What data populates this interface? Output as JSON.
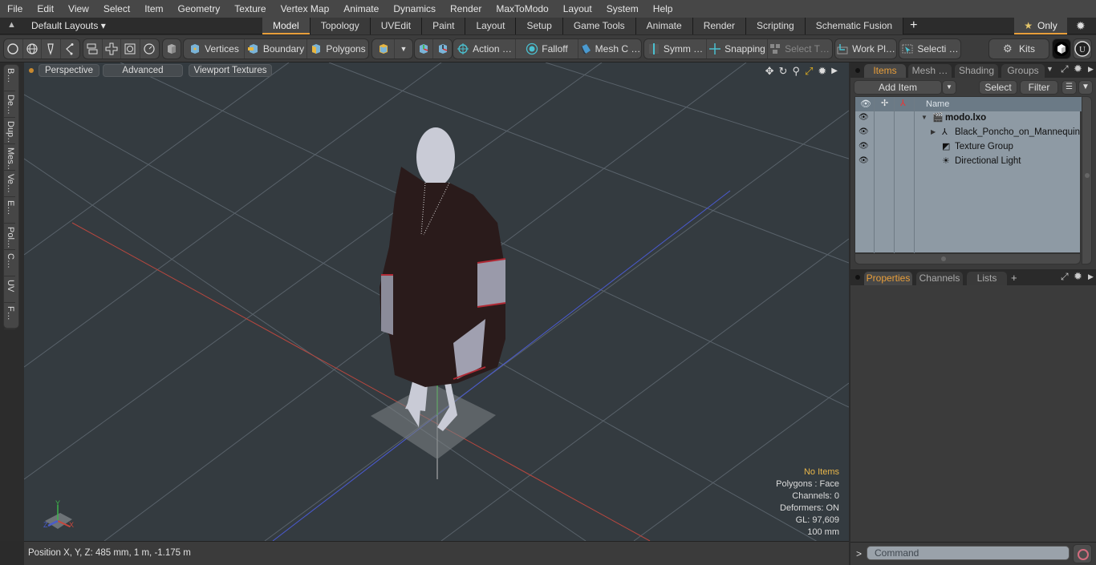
{
  "menubar": {
    "items": [
      "File",
      "Edit",
      "View",
      "Select",
      "Item",
      "Geometry",
      "Texture",
      "Vertex Map",
      "Animate",
      "Dynamics",
      "Render",
      "MaxToModo",
      "Layout",
      "System",
      "Help"
    ]
  },
  "layoutbar": {
    "layouts_label": "Default Layouts ▾",
    "tabs": [
      "Model",
      "Topology",
      "UVEdit",
      "Paint",
      "Layout",
      "Setup",
      "Game Tools",
      "Animate",
      "Render",
      "Scripting",
      "Schematic Fusion"
    ],
    "active_tab": "Model",
    "add_tab": "+",
    "only_label": "Only",
    "star": "★"
  },
  "toolbar": {
    "mode_buttons": {
      "vertices": "Vertices",
      "boundary": "Boundary",
      "polygons": "Polygons"
    },
    "action": "Action …",
    "falloff": "Falloff",
    "mesh": "Mesh C …",
    "symmetry": "Symm …",
    "snapping": "Snapping",
    "select_through": "Select T…",
    "work_plane": "Work Pl…",
    "selection": "Selecti …",
    "kits": "Kits"
  },
  "left_strip": {
    "tabs": [
      "B…",
      "De…",
      "Dup…",
      "Mes…",
      "Ve…",
      "E…",
      "Pol…",
      "C…",
      "UV",
      "F…"
    ]
  },
  "viewport": {
    "view_mode": "Perspective",
    "shading": "Advanced",
    "textures": "Viewport Textures",
    "hud": {
      "selection": "No Items",
      "polygons": "Polygons : Face",
      "channels": "Channels: 0",
      "deformers": "Deformers: ON",
      "gl": "GL: 97,609",
      "grid": "100 mm"
    },
    "axes": {
      "x": "X",
      "y": "Y",
      "z": "Z"
    }
  },
  "status": {
    "position": "Position X, Y, Z:   485 mm, 1 m, -1.175 m"
  },
  "items_panel": {
    "tabs": [
      "Items",
      "Mesh …",
      "Shading",
      "Groups"
    ],
    "active_tab": "Items",
    "add_item": "Add Item",
    "select": "Select",
    "filter": "Filter",
    "column_name": "Name",
    "tree": [
      {
        "label": "modo.lxo",
        "level": 0,
        "expander": "▼",
        "icon": "scene-icon",
        "bold": true
      },
      {
        "label": "Black_Poncho_on_Mannequin",
        "level": 1,
        "expander": "▶",
        "icon": "mesh-locator-icon",
        "bold": false
      },
      {
        "label": "Texture Group",
        "level": 1,
        "expander": "",
        "icon": "texture-group-icon",
        "bold": false
      },
      {
        "label": "Directional Light",
        "level": 1,
        "expander": "",
        "icon": "directional-light-icon",
        "bold": false
      }
    ]
  },
  "properties_panel": {
    "tabs": [
      "Properties",
      "Channels",
      "Lists"
    ],
    "active_tab": "Properties",
    "add_tab": "+"
  },
  "command": {
    "prompt": ">",
    "placeholder": "Command"
  },
  "colors": {
    "accent": "#e89e3a",
    "viewport_bg": "#343b40",
    "axis_x": "#c8463c",
    "axis_y": "#3cb44a",
    "axis_z": "#4a5cc8"
  }
}
